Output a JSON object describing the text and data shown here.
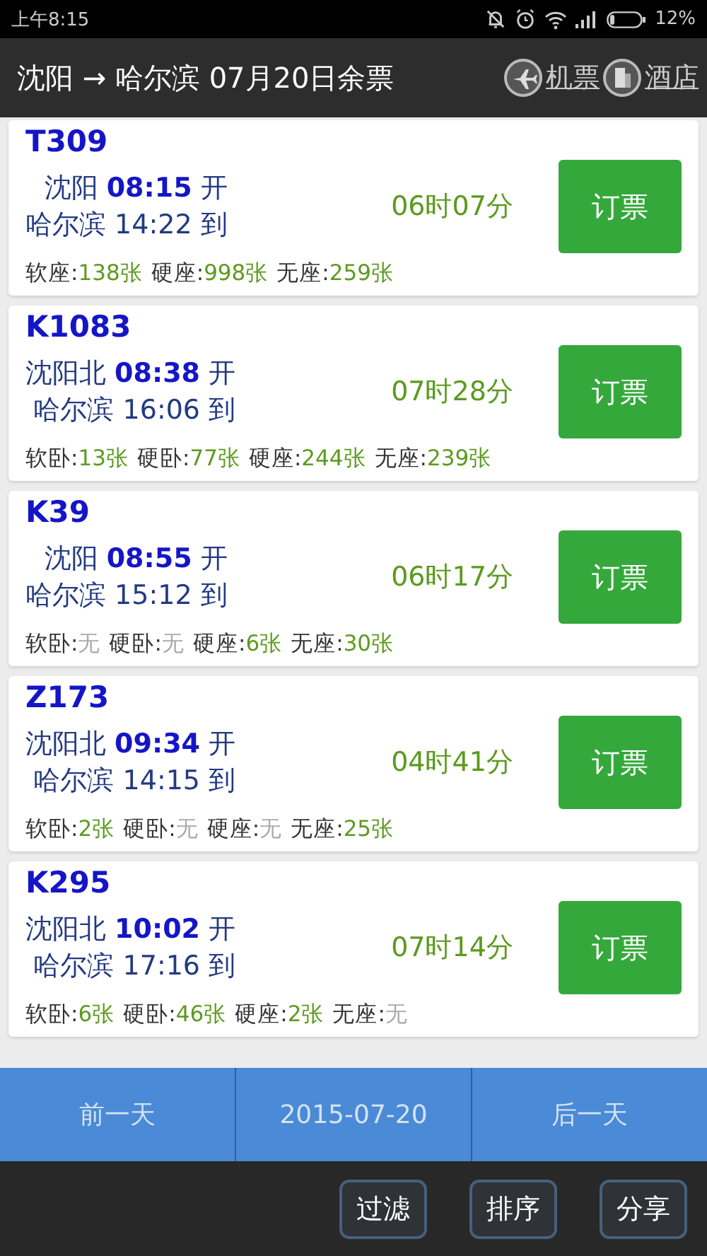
{
  "status_bar": {
    "time": "上午8:15",
    "battery": "12%"
  },
  "header": {
    "title": "沈阳 → 哈尔滨 07月20日余票",
    "links": [
      "机票",
      "酒店"
    ]
  },
  "trains": [
    {
      "number": "T309",
      "from": "沈阳",
      "depart": "08:15",
      "depart_suffix": "开",
      "to": "哈尔滨",
      "arrive": "14:22",
      "arrive_suffix": "到",
      "duration": "06时07分",
      "button": "订票",
      "seats": [
        {
          "label": "软座:",
          "value": "138张",
          "available": true
        },
        {
          "label": "硬座:",
          "value": "998张",
          "available": true
        },
        {
          "label": "无座:",
          "value": "259张",
          "available": true
        }
      ]
    },
    {
      "number": "K1083",
      "from": "沈阳北",
      "depart": "08:38",
      "depart_suffix": "开",
      "to": "哈尔滨",
      "arrive": "16:06",
      "arrive_suffix": "到",
      "duration": "07时28分",
      "button": "订票",
      "seats": [
        {
          "label": "软卧:",
          "value": "13张",
          "available": true
        },
        {
          "label": "硬卧:",
          "value": "77张",
          "available": true
        },
        {
          "label": "硬座:",
          "value": "244张",
          "available": true
        },
        {
          "label": "无座:",
          "value": "239张",
          "available": true
        }
      ]
    },
    {
      "number": "K39",
      "from": "沈阳",
      "depart": "08:55",
      "depart_suffix": "开",
      "to": "哈尔滨",
      "arrive": "15:12",
      "arrive_suffix": "到",
      "duration": "06时17分",
      "button": "订票",
      "seats": [
        {
          "label": "软卧:",
          "value": "无",
          "available": false
        },
        {
          "label": "硬卧:",
          "value": "无",
          "available": false
        },
        {
          "label": "硬座:",
          "value": "6张",
          "available": true
        },
        {
          "label": "无座:",
          "value": "30张",
          "available": true
        }
      ]
    },
    {
      "number": "Z173",
      "from": "沈阳北",
      "depart": "09:34",
      "depart_suffix": "开",
      "to": "哈尔滨",
      "arrive": "14:15",
      "arrive_suffix": "到",
      "duration": "04时41分",
      "button": "订票",
      "seats": [
        {
          "label": "软卧:",
          "value": "2张",
          "available": true
        },
        {
          "label": "硬卧:",
          "value": "无",
          "available": false
        },
        {
          "label": "硬座:",
          "value": "无",
          "available": false
        },
        {
          "label": "无座:",
          "value": "25张",
          "available": true
        }
      ]
    },
    {
      "number": "K295",
      "from": "沈阳北",
      "depart": "10:02",
      "depart_suffix": "开",
      "to": "哈尔滨",
      "arrive": "17:16",
      "arrive_suffix": "到",
      "duration": "07时14分",
      "button": "订票",
      "seats": [
        {
          "label": "软卧:",
          "value": "6张",
          "available": true
        },
        {
          "label": "硬卧:",
          "value": "46张",
          "available": true
        },
        {
          "label": "硬座:",
          "value": "2张",
          "available": true
        },
        {
          "label": "无座:",
          "value": "无",
          "available": false
        }
      ]
    }
  ],
  "date_bar": {
    "prev": "前一天",
    "date": "2015-07-20",
    "next": "后一天"
  },
  "toolbar": {
    "buttons": [
      "过滤",
      "排序",
      "分享"
    ]
  }
}
